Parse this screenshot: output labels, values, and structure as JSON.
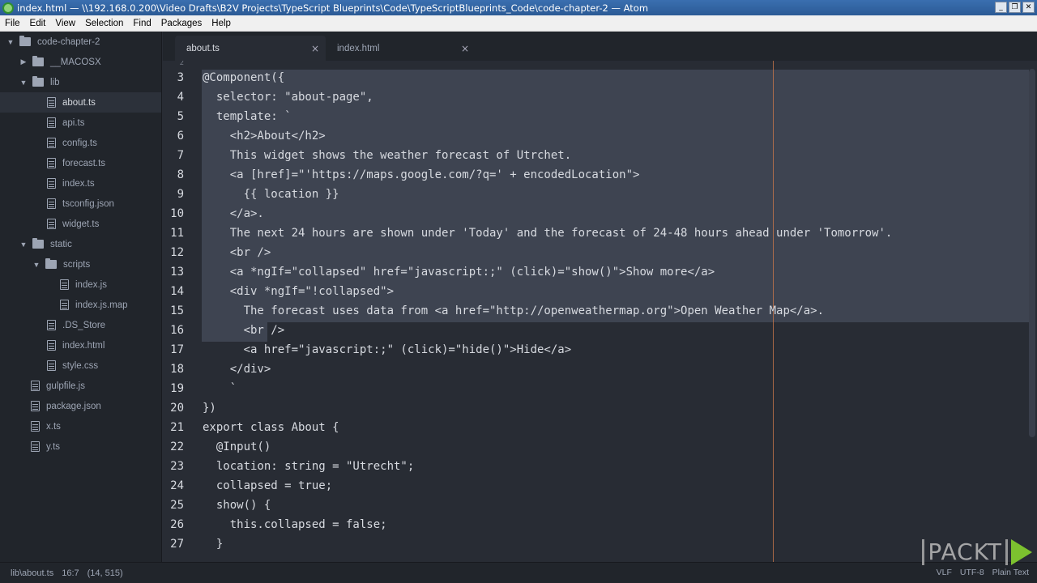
{
  "window": {
    "title": "index.html — \\\\192.168.0.200\\Video Drafts\\B2V Projects\\TypeScript Blueprints\\Code\\TypeScriptBlueprints_Code\\code-chapter-2 — Atom",
    "minimize": "_",
    "maximize": "❐",
    "close": "✕"
  },
  "menu": [
    "File",
    "Edit",
    "View",
    "Selection",
    "Find",
    "Packages",
    "Help"
  ],
  "tree": [
    {
      "label": "code-chapter-2",
      "type": "folder",
      "expanded": true
    },
    {
      "label": "__MACOSX",
      "type": "folder",
      "expanded": false
    },
    {
      "label": "lib",
      "type": "folder",
      "expanded": true
    },
    {
      "label": "about.ts",
      "type": "file",
      "selected": true
    },
    {
      "label": "api.ts",
      "type": "file"
    },
    {
      "label": "config.ts",
      "type": "file"
    },
    {
      "label": "forecast.ts",
      "type": "file"
    },
    {
      "label": "index.ts",
      "type": "file"
    },
    {
      "label": "tsconfig.json",
      "type": "file"
    },
    {
      "label": "widget.ts",
      "type": "file"
    },
    {
      "label": "static",
      "type": "folder",
      "expanded": true
    },
    {
      "label": "scripts",
      "type": "folder",
      "expanded": true
    },
    {
      "label": "index.js",
      "type": "file"
    },
    {
      "label": "index.js.map",
      "type": "file"
    },
    {
      "label": ".DS_Store",
      "type": "file"
    },
    {
      "label": "index.html",
      "type": "file"
    },
    {
      "label": "style.css",
      "type": "file"
    },
    {
      "label": "gulpfile.js",
      "type": "file"
    },
    {
      "label": "package.json",
      "type": "file"
    },
    {
      "label": "x.ts",
      "type": "file"
    },
    {
      "label": "y.ts",
      "type": "file"
    }
  ],
  "tabs": [
    {
      "label": "about.ts",
      "active": true,
      "close": "×"
    },
    {
      "label": "index.html",
      "active": false,
      "close": "×"
    }
  ],
  "editor": {
    "top_line_number": "2",
    "lines": [
      {
        "n": "3",
        "text": "@Component({",
        "selected": true
      },
      {
        "n": "4",
        "text": "  selector: \"about-page\",",
        "selected": true
      },
      {
        "n": "5",
        "text": "  template: `",
        "selected": true
      },
      {
        "n": "6",
        "text": "    <h2>About</h2>",
        "selected": true
      },
      {
        "n": "7",
        "text": "    This widget shows the weather forecast of Utrchet.",
        "selected": true
      },
      {
        "n": "8",
        "text": "    <a [href]=\"'https://maps.google.com/?q=' + encodedLocation\">",
        "selected": true
      },
      {
        "n": "9",
        "text": "      {{ location }}",
        "selected": true
      },
      {
        "n": "10",
        "text": "    </a>.",
        "selected": true
      },
      {
        "n": "11",
        "text": "    The next 24 hours are shown under 'Today' and the forecast of 24-48 hours ahead under 'Tomorrow'.",
        "selected": true
      },
      {
        "n": "12",
        "text": "    <br />",
        "selected": true
      },
      {
        "n": "13",
        "text": "    <a *ngIf=\"collapsed\" href=\"javascript:;\" (click)=\"show()\">Show more</a>",
        "selected": true
      },
      {
        "n": "14",
        "text": "    <div *ngIf=\"!collapsed\">",
        "selected": true
      },
      {
        "n": "15",
        "text": "      The forecast uses data from <a href=\"http://openweathermap.org\">Open Weather Map</a>.",
        "selected": true
      },
      {
        "n": "16",
        "text": "      <br />",
        "selected": "partial"
      },
      {
        "n": "17",
        "text": "      <a href=\"javascript:;\" (click)=\"hide()\">Hide</a>",
        "selected": false
      },
      {
        "n": "18",
        "text": "    </div>",
        "selected": false
      },
      {
        "n": "19",
        "text": "    `",
        "selected": false
      },
      {
        "n": "20",
        "text": "})",
        "selected": false
      },
      {
        "n": "21",
        "text": "export class About {",
        "selected": false
      },
      {
        "n": "22",
        "text": "  @Input()",
        "selected": false
      },
      {
        "n": "23",
        "text": "  location: string = \"Utrecht\";",
        "selected": false
      },
      {
        "n": "24",
        "text": "  collapsed = true;",
        "selected": false
      },
      {
        "n": "25",
        "text": "  show() {",
        "selected": false
      },
      {
        "n": "26",
        "text": "    this.collapsed = false;",
        "selected": false
      },
      {
        "n": "27",
        "text": "  }",
        "selected": false
      }
    ]
  },
  "status": {
    "path": "lib\\about.ts",
    "cursor": "16:7",
    "selection": "(14, 515)",
    "line_ending": "VLF",
    "encoding": "UTF-8",
    "grammar": "Plain Text"
  },
  "watermark": {
    "text": "PACKT"
  }
}
